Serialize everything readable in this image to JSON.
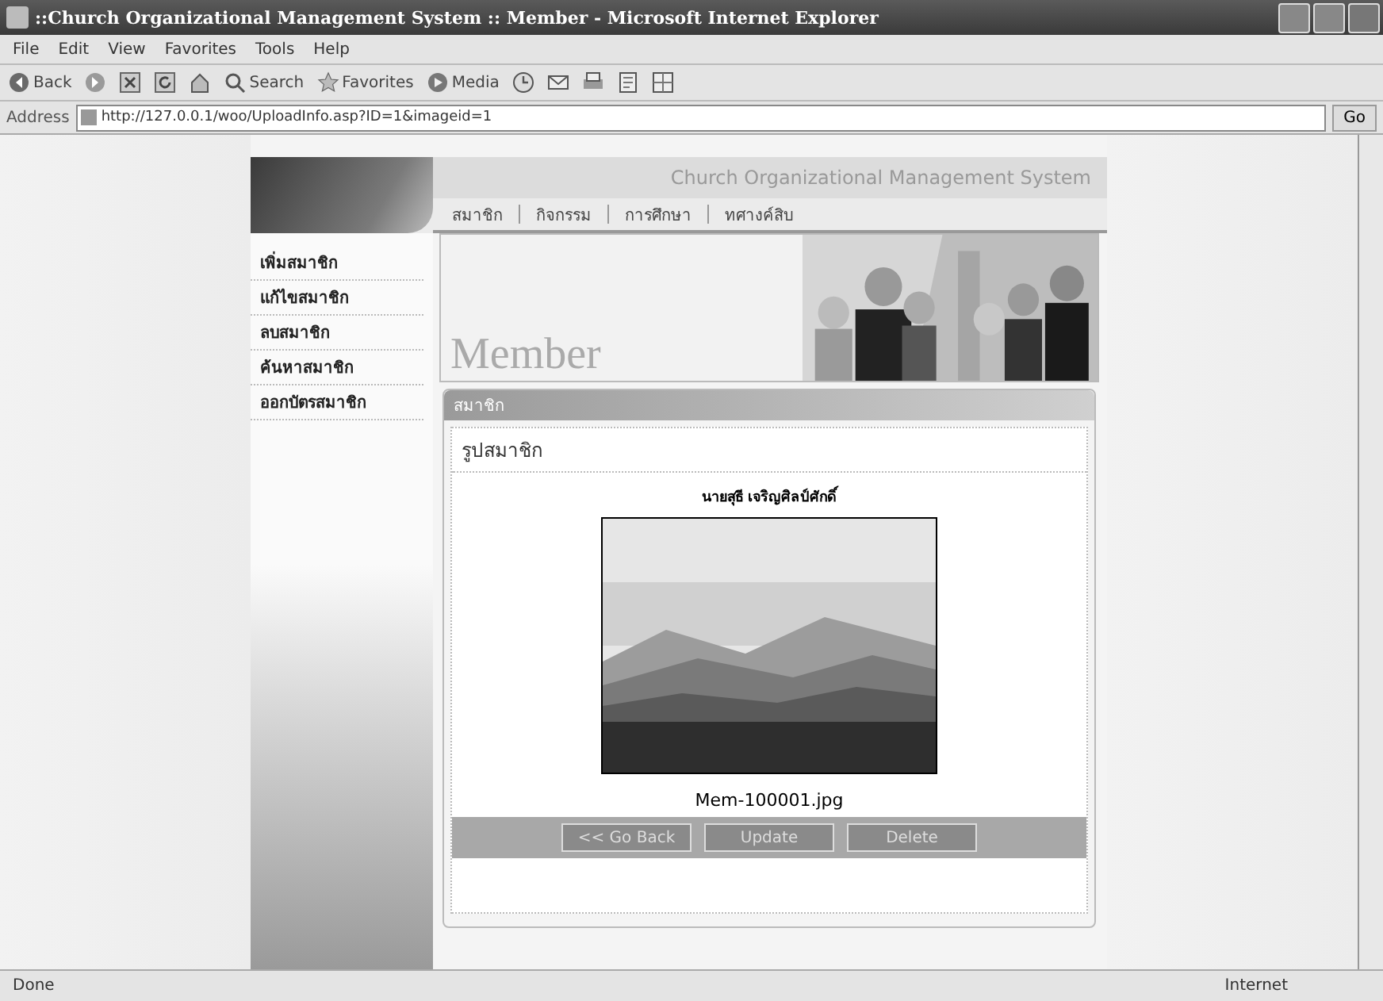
{
  "window": {
    "title": "::Church Organizational Management System :: Member - Microsoft Internet Explorer"
  },
  "menu_bar": [
    "File",
    "Edit",
    "View",
    "Favorites",
    "Tools",
    "Help"
  ],
  "toolbar": [
    {
      "kind": "back",
      "label": "Back"
    },
    {
      "kind": "forward"
    },
    {
      "kind": "stop"
    },
    {
      "kind": "refresh"
    },
    {
      "kind": "home"
    },
    {
      "kind": "search",
      "label": "Search"
    },
    {
      "kind": "favorites",
      "label": "Favorites"
    },
    {
      "kind": "media",
      "label": "Media"
    },
    {
      "kind": "history"
    },
    {
      "kind": "mail"
    },
    {
      "kind": "print"
    },
    {
      "kind": "edit"
    },
    {
      "kind": "discuss"
    }
  ],
  "address_bar": {
    "label": "Address",
    "value": "http://127.0.0.1/woo/UploadInfo.asp?ID=1&imageid=1",
    "go": "Go"
  },
  "site": {
    "title": "Church Organizational Management System",
    "nav": [
      "สมาชิก",
      "กิจกรรม",
      "การศึกษา",
      "ทศางค์สิบ"
    ],
    "sidebar": [
      "เพิ่มสมาชิก",
      "แก้ไขสมาชิก",
      "ลบสมาชิก",
      "ค้นหาสมาชิก",
      "ออกบัตรสมาชิก"
    ],
    "banner_title": "Member",
    "panel": {
      "header": "สมาชิก",
      "title": "รูปสมาชิก",
      "member_name": "นายสุธี เจริญศิลป์ศักดิ์",
      "file_name": "Mem-100001.jpg",
      "buttons": [
        "<< Go Back",
        "Update",
        "Delete"
      ]
    }
  },
  "status_bar": {
    "text": "Done",
    "zone": "Internet"
  }
}
